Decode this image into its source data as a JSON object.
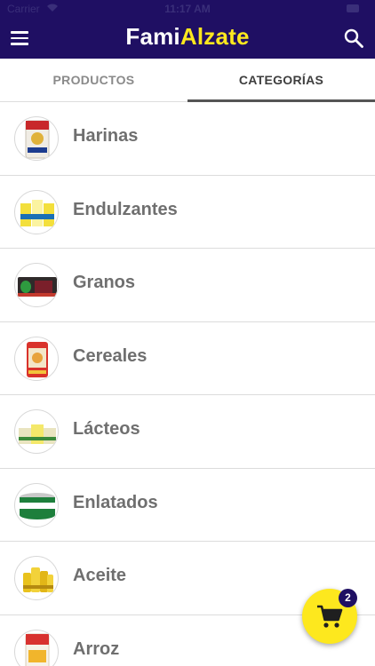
{
  "status_bar": {
    "carrier": "Carrier",
    "time": "11:17 AM"
  },
  "header": {
    "logo_part1": "Fami",
    "logo_part2": "Alzate"
  },
  "tabs": [
    {
      "label": "PRODUCTOS",
      "active": false
    },
    {
      "label": "CATEGORÍAS",
      "active": true
    }
  ],
  "categories": [
    {
      "label": "Harinas"
    },
    {
      "label": "Endulzantes"
    },
    {
      "label": "Granos"
    },
    {
      "label": "Cereales"
    },
    {
      "label": "Lácteos"
    },
    {
      "label": "Enlatados"
    },
    {
      "label": "Aceite"
    },
    {
      "label": "Arroz"
    }
  ],
  "cart": {
    "count": "2"
  },
  "colors": {
    "header_bg": "#1f0f63",
    "accent": "#fde81e",
    "label_text": "#6f6f6f"
  }
}
